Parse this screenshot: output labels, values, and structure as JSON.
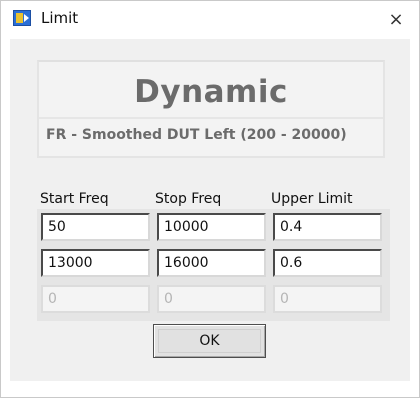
{
  "window": {
    "title": "Limit",
    "close_glyph": "×"
  },
  "header": {
    "title": "Dynamic",
    "subtitle": "FR - Smoothed DUT Left (200 - 20000)"
  },
  "table": {
    "columns": [
      "Start Freq",
      "Stop Freq",
      "Upper Limit"
    ],
    "rows": [
      [
        "50",
        "10000",
        "0.4"
      ],
      [
        "13000",
        "16000",
        "0.6"
      ],
      [
        "0",
        "0",
        "0"
      ]
    ]
  },
  "footer": {
    "ok_label": "OK"
  },
  "icons": {
    "app_icon": "labview-app-icon",
    "close_icon": "close-icon"
  },
  "colors": {
    "title_text": "#6b6b6b",
    "background": "#f0f0f0",
    "app_icon_blue": "#2b6fd6",
    "app_icon_yellow": "#e9c230"
  }
}
